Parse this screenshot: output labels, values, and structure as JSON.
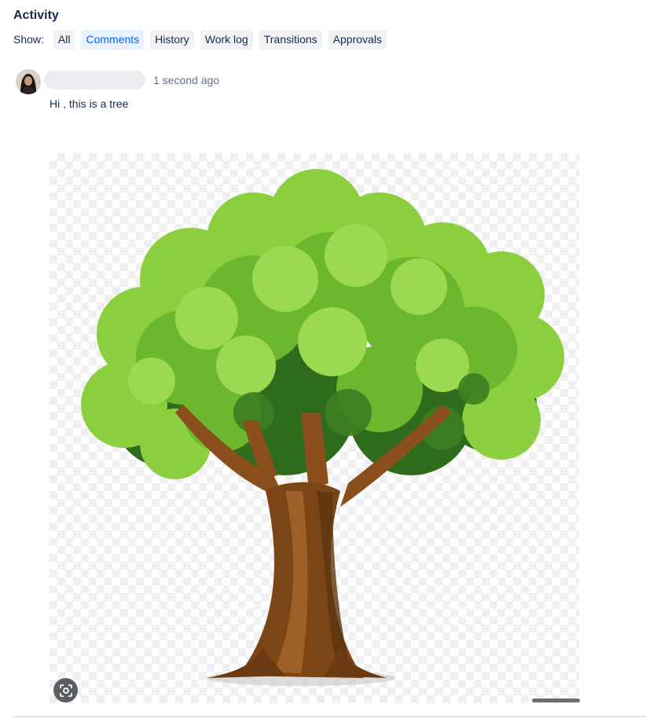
{
  "activity": {
    "title": "Activity",
    "show_label": "Show:",
    "filters": [
      {
        "label": "All",
        "active": false
      },
      {
        "label": "Comments",
        "active": true
      },
      {
        "label": "History",
        "active": false
      },
      {
        "label": "Work log",
        "active": false
      },
      {
        "label": "Transitions",
        "active": false
      },
      {
        "label": "Approvals",
        "active": false
      }
    ]
  },
  "comment": {
    "timestamp": "1 second ago",
    "body": "Hi , this is a tree",
    "attachment_icon": "tree-image",
    "lens_icon": "visual-search-icon"
  },
  "colors": {
    "accent": "#0c66e4",
    "text": "#172b4d",
    "subtle_text": "#626f86",
    "chip_bg": "#f1f2f4",
    "active_chip_bg": "#e9f2ff"
  }
}
